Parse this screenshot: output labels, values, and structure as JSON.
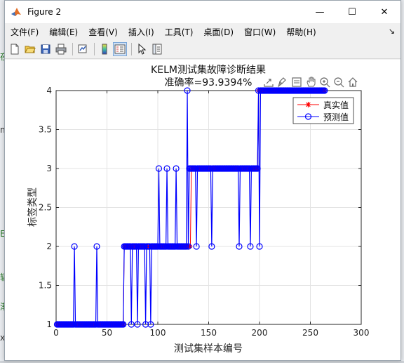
{
  "window": {
    "title": "Figure 2",
    "controls": {
      "minimize": "—",
      "maximize": "☐",
      "close": "✕"
    }
  },
  "menu": {
    "items": [
      "文件(F)",
      "编辑(E)",
      "查看(V)",
      "插入(I)",
      "工具(T)",
      "桌面(D)",
      "窗口(W)",
      "帮助(H)"
    ],
    "overflow_icon": "arrow-corner-icon"
  },
  "toolbar": {
    "icons": [
      "new-figure-icon",
      "open-file-icon",
      "save-icon",
      "print-icon",
      "link-plot-icon",
      "colorbar-icon",
      "legend-icon",
      "pointer-icon",
      "property-inspector-icon"
    ]
  },
  "axes_toolbar": {
    "icons": [
      "export-icon",
      "brush-icon",
      "datatip-icon",
      "pan-icon",
      "zoom-in-icon",
      "zoom-out-icon",
      "home-icon"
    ]
  },
  "background_fragments": [
    "夜",
    "n",
    "E",
    "辐",
    "渐",
    "x"
  ],
  "chart_data": {
    "type": "line",
    "title": "KELM测试集故障诊断结果",
    "subtitle": "准确率=93.9394%",
    "xlabel": "测试集样本编号",
    "ylabel": "标签类型",
    "xlim": [
      0,
      300
    ],
    "ylim": [
      1,
      4
    ],
    "xticks": [
      0,
      50,
      100,
      150,
      200,
      250,
      300
    ],
    "yticks": [
      1,
      1.5,
      2,
      2.5,
      3,
      3.5,
      4
    ],
    "xtick_labels": [
      "0",
      "50",
      "100",
      "150",
      "200",
      "250",
      "300"
    ],
    "ytick_labels": [
      "1",
      "1.5",
      "2",
      "2.5",
      "3",
      "3.5",
      "4"
    ],
    "grid": true,
    "legend_position": "top-right",
    "n_samples": 264,
    "true_segments": [
      {
        "from": 1,
        "to": 66,
        "value": 1
      },
      {
        "from": 67,
        "to": 132,
        "value": 2
      },
      {
        "from": 133,
        "to": 198,
        "value": 3
      },
      {
        "from": 199,
        "to": 264,
        "value": 4
      }
    ],
    "prediction_errors": [
      {
        "x": 18,
        "value": 2
      },
      {
        "x": 40,
        "value": 2
      },
      {
        "x": 74,
        "value": 1
      },
      {
        "x": 80,
        "value": 1
      },
      {
        "x": 88,
        "value": 1
      },
      {
        "x": 93,
        "value": 1
      },
      {
        "x": 101,
        "value": 3
      },
      {
        "x": 109,
        "value": 3
      },
      {
        "x": 118,
        "value": 3
      },
      {
        "x": 129,
        "value": 4
      },
      {
        "x": 131,
        "value": 3
      },
      {
        "x": 132,
        "value": 3
      },
      {
        "x": 138,
        "value": 2
      },
      {
        "x": 153,
        "value": 2
      },
      {
        "x": 180,
        "value": 2
      },
      {
        "x": 191,
        "value": 2
      },
      {
        "x": 200,
        "value": 2
      }
    ],
    "series": [
      {
        "name": "真实值",
        "color": "#ff0000",
        "marker": "asterisk"
      },
      {
        "name": "预测值",
        "color": "#0000ff",
        "marker": "circle"
      }
    ]
  }
}
